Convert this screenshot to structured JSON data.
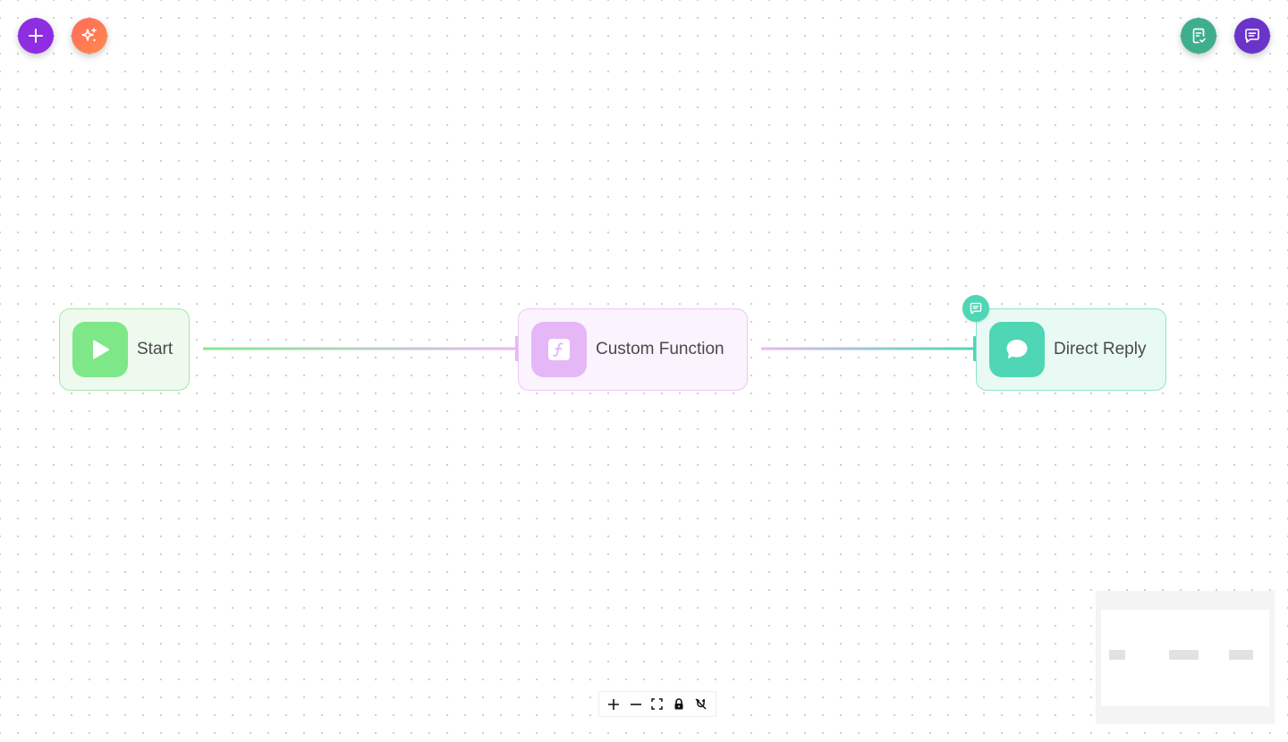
{
  "canvas": {
    "background": "#ffffff",
    "dot_color": "#c9cdd3"
  },
  "top_left_actions": [
    {
      "name": "add-node",
      "icon": "plus-icon",
      "color": "#8e2de2"
    },
    {
      "name": "ai-assistant",
      "icon": "sparkles-icon",
      "color": "#ff7055"
    }
  ],
  "top_right_actions": [
    {
      "name": "validate",
      "icon": "clipboard-check-icon",
      "color": "#3fae8c"
    },
    {
      "name": "chat",
      "icon": "message-square-icon",
      "color": "#6b34c9"
    }
  ],
  "nodes": [
    {
      "id": "start",
      "label": "Start",
      "icon": "play-icon",
      "color": "#7ee787"
    },
    {
      "id": "custom-function",
      "label": "Custom Function",
      "icon": "function-icon",
      "color": "#e5b7f7"
    },
    {
      "id": "direct-reply",
      "label": "Direct Reply",
      "icon": "chat-bubble-icon",
      "color": "#4fd6b4",
      "badge_icon": "message-square-icon"
    }
  ],
  "edges": [
    {
      "from": "start",
      "to": "custom-function",
      "gradient": [
        "#86e88e",
        "#e7b8f5"
      ]
    },
    {
      "from": "custom-function",
      "to": "direct-reply",
      "gradient": [
        "#e7b8f5",
        "#4fd6b4"
      ]
    }
  ],
  "controls": [
    {
      "name": "zoom-in",
      "icon": "plus-icon"
    },
    {
      "name": "zoom-out",
      "icon": "minus-icon"
    },
    {
      "name": "fit-view",
      "icon": "maximize-icon"
    },
    {
      "name": "lock",
      "icon": "lock-icon"
    },
    {
      "name": "unlink",
      "icon": "magnet-off-icon"
    }
  ],
  "minimap": {
    "background": "#f4f4f4",
    "node_color": "#e2e2e2"
  }
}
